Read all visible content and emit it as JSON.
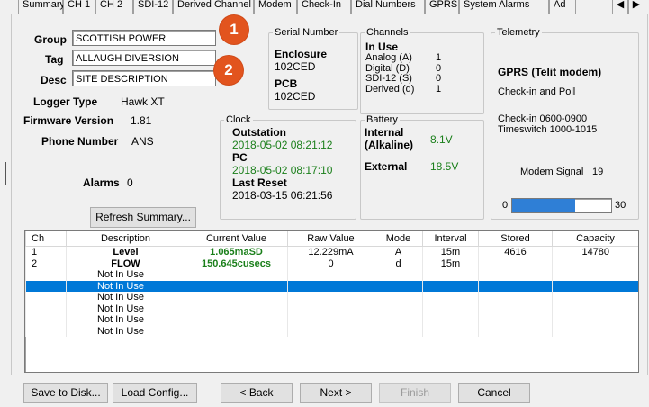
{
  "tabs": [
    "Summary",
    "CH 1",
    "CH 2",
    "SDI-12",
    "Derived Channel",
    "Modem",
    "Check-In",
    "Dial Numbers",
    "GPRS",
    "System Alarms",
    "Ad"
  ],
  "left": {
    "group_label": "Group",
    "group_value": "SCOTTISH POWER",
    "tag_label": "Tag",
    "tag_value": "ALLAUGH DIVERSION",
    "desc_label": "Desc",
    "desc_value": "SITE DESCRIPTION",
    "logger_type_label": "Logger Type",
    "logger_type_value": "Hawk XT",
    "firmware_label": "Firmware Version",
    "firmware_value": "1.81",
    "phone_label": "Phone Number",
    "phone_value": "ANS",
    "alarms_label": "Alarms",
    "alarms_value": "0",
    "refresh_button": "Refresh Summary..."
  },
  "badges": [
    "1",
    "2"
  ],
  "serial": {
    "legend": "Serial Number",
    "enclosure_label": "Enclosure",
    "enclosure_value": "102CED",
    "pcb_label": "PCB",
    "pcb_value": "102CED"
  },
  "channels": {
    "legend": "Channels",
    "heading": "In Use",
    "rows": [
      {
        "label": "Analog (A)",
        "value": "1"
      },
      {
        "label": "Digital (D)",
        "value": "0"
      },
      {
        "label": "SDI-12 (S)",
        "value": "0"
      },
      {
        "label": "Derived (d)",
        "value": "1"
      }
    ]
  },
  "telemetry": {
    "legend": "Telemetry",
    "modem": "GPRS (Telit modem)",
    "mode": "Check-in and Poll",
    "checkin": "Check-in 0600-0900",
    "timeswitch": "Timeswitch 1000-1015",
    "signal_label": "Modem Signal",
    "signal_value": "19",
    "bar_min": "0",
    "bar_max": "30",
    "signal_fraction": 0.633
  },
  "clock": {
    "legend": "Clock",
    "outstation_label": "Outstation",
    "outstation_value": "2018-05-02 08:21:12",
    "pc_label": "PC",
    "pc_value": "2018-05-02 08:17:10",
    "reset_label": "Last Reset",
    "reset_value": "2018-03-15 06:21:56"
  },
  "battery": {
    "legend": "Battery",
    "internal_label": "Internal",
    "internal_sub": "(Alkaline)",
    "internal_value": "8.1V",
    "external_label": "External",
    "external_value": "18.5V"
  },
  "table": {
    "headers": [
      "Ch",
      "Description",
      "Current Value",
      "Raw Value",
      "Mode",
      "Interval",
      "Stored",
      "Capacity"
    ],
    "rows": [
      {
        "ch": "1",
        "desc": "Level",
        "current": "1.065maSD",
        "raw": "12.229mA",
        "mode": "A",
        "interval": "15m",
        "stored": "4616",
        "capacity": "14780"
      },
      {
        "ch": "2",
        "desc": "FLOW",
        "current": "150.645cusecs",
        "raw": "0",
        "mode": "d",
        "interval": "15m",
        "stored": "",
        "capacity": ""
      },
      {
        "ch": "",
        "desc": "Not In Use",
        "current": "",
        "raw": "",
        "mode": "",
        "interval": "",
        "stored": "",
        "capacity": ""
      },
      {
        "ch": "",
        "desc": "Not In Use",
        "current": "",
        "raw": "",
        "mode": "",
        "interval": "",
        "stored": "",
        "capacity": ""
      },
      {
        "ch": "",
        "desc": "Not In Use",
        "current": "",
        "raw": "",
        "mode": "",
        "interval": "",
        "stored": "",
        "capacity": ""
      },
      {
        "ch": "",
        "desc": "Not In Use",
        "current": "",
        "raw": "",
        "mode": "",
        "interval": "",
        "stored": "",
        "capacity": ""
      },
      {
        "ch": "",
        "desc": "Not In Use",
        "current": "",
        "raw": "",
        "mode": "",
        "interval": "",
        "stored": "",
        "capacity": ""
      },
      {
        "ch": "",
        "desc": "Not In Use",
        "current": "",
        "raw": "",
        "mode": "",
        "interval": "",
        "stored": "",
        "capacity": ""
      }
    ],
    "selected_row": 3
  },
  "buttons": {
    "save": "Save to Disk...",
    "load": "Load Config...",
    "back": "< Back",
    "next": "Next >",
    "finish": "Finish",
    "cancel": "Cancel"
  },
  "colors": {
    "badge": "#e2541e",
    "selection": "#0078d7",
    "value_green": "#1a7f1a",
    "signal_bar": "#2f7fd6"
  }
}
